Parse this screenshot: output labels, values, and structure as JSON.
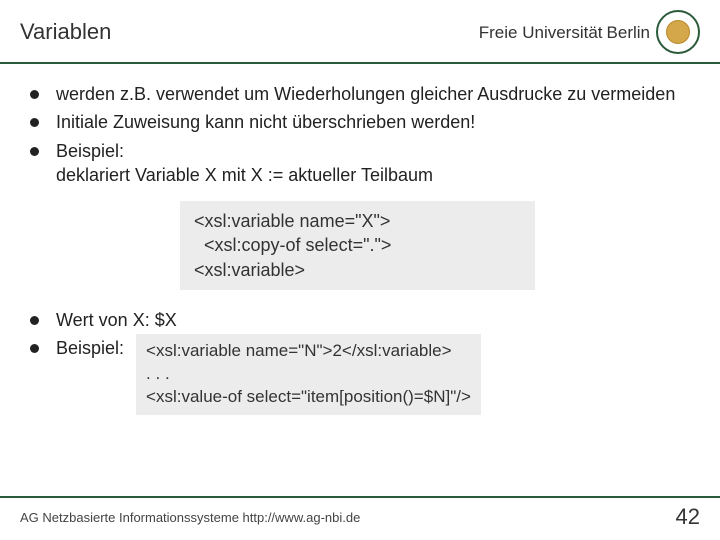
{
  "header": {
    "title": "Variablen",
    "logo_pre": "Freie Universität",
    "logo_city": "Berlin"
  },
  "bullets": {
    "b1": "werden z.B. verwendet um Wiederholungen gleicher Ausdrucke zu vermeiden",
    "b2": "Initiale Zuweisung kann nicht überschrieben werden!",
    "b3": "Beispiel:\ndeklariert Variable X mit X := aktueller Teilbaum"
  },
  "code1": "<xsl:variable name=\"X\">\n  <xsl:copy-of select=\".\">\n<xsl:variable>",
  "lower": {
    "l1": "Wert von X: $X",
    "l2": "Beispiel:"
  },
  "code2": "<xsl:variable name=\"N\">2</xsl:variable>\n. . .\n<xsl:value-of select=\"item[position()=$N]\"/>",
  "footer": {
    "left": "AG Netzbasierte Informationssysteme http://www.ag-nbi.de",
    "page": "42"
  }
}
